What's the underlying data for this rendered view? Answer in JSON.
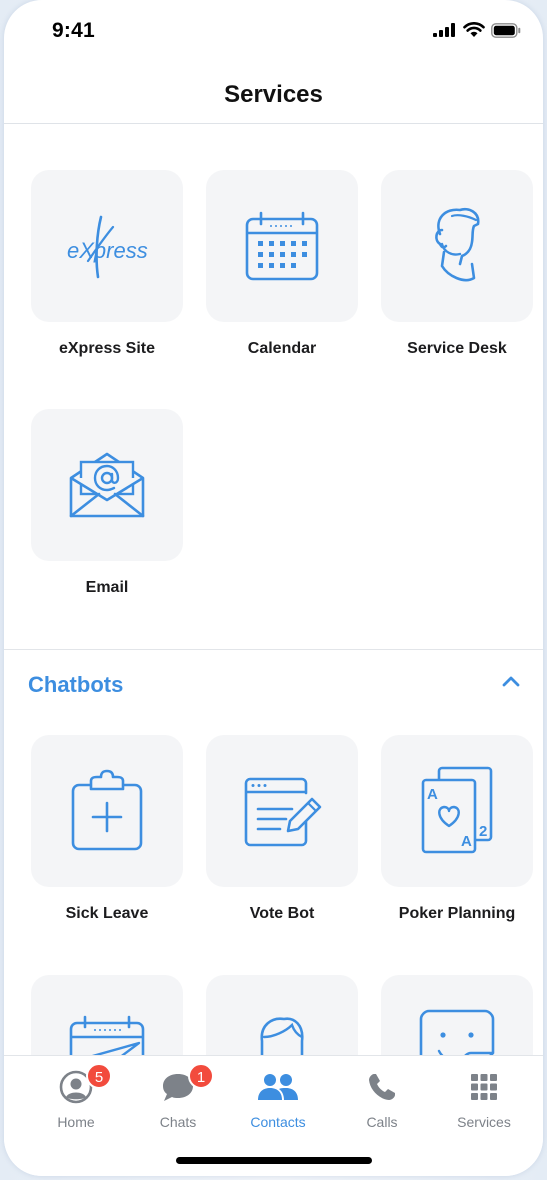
{
  "status_bar": {
    "time": "9:41"
  },
  "header": {
    "title": "Services"
  },
  "services": [
    {
      "label": "eXpress Site",
      "icon": "express-logo-icon"
    },
    {
      "label": "Calendar",
      "icon": "calendar-icon"
    },
    {
      "label": "Service Desk",
      "icon": "support-agent-icon"
    },
    {
      "label": "Email",
      "icon": "email-icon"
    }
  ],
  "express_logo": {
    "text": "eXpress"
  },
  "chatbots": {
    "title": "Chatbots",
    "items": [
      {
        "label": "Sick Leave",
        "icon": "clipboard-plus-icon"
      },
      {
        "label": "Vote Bot",
        "icon": "form-edit-icon"
      },
      {
        "label": "Poker Planning",
        "icon": "playing-cards-icon"
      },
      {
        "label": "",
        "icon": "calendar-plane-icon"
      },
      {
        "label": "",
        "icon": "person-head-icon"
      },
      {
        "label": "",
        "icon": "sticker-face-icon"
      }
    ]
  },
  "playing_cards": {
    "rank_a": "A",
    "rank_2": "2"
  },
  "tabbar": {
    "tabs": [
      {
        "label": "Home",
        "badge": "5",
        "icon": "person-circle-icon"
      },
      {
        "label": "Chats",
        "badge": "1",
        "icon": "chat-bubble-icon"
      },
      {
        "label": "Contacts",
        "badge": "",
        "icon": "people-icon",
        "active": true
      },
      {
        "label": "Calls",
        "badge": "",
        "icon": "phone-icon"
      },
      {
        "label": "Services",
        "badge": "",
        "icon": "grid-icon"
      }
    ]
  },
  "colors": {
    "accent": "#3d8ee0",
    "badge": "#f24b3d",
    "tile_bg": "#f4f5f7"
  }
}
